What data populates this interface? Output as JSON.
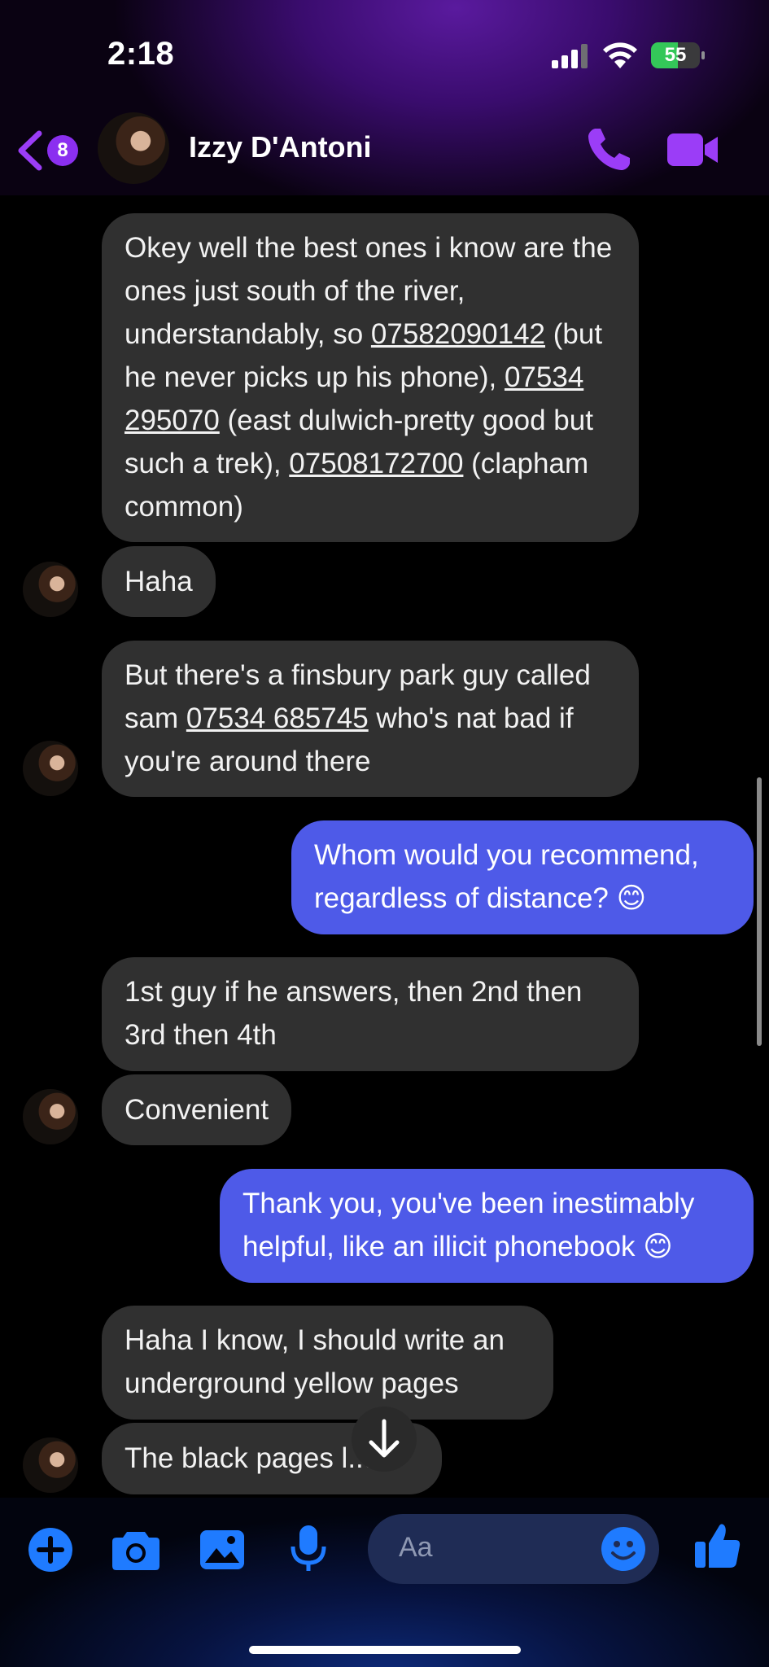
{
  "status_bar": {
    "time": "2:18",
    "battery_level": "55",
    "battery_fraction": 0.55
  },
  "header": {
    "unread_count": "8",
    "contact_name": "Izzy D'Antoni",
    "accent_color": "#9b3df7"
  },
  "messages": [
    {
      "from": "them",
      "segments": [
        {
          "t": "Okey well the best ones i know are the ones just south of the river, understandably, so "
        },
        {
          "t": "07582090142",
          "phone": true
        },
        {
          "t": " (but he never picks up his phone), "
        },
        {
          "t": "07534 295070",
          "phone": true
        },
        {
          "t": " (east dulwich-pretty good but such a trek), "
        },
        {
          "t": "07508172700",
          "phone": true
        },
        {
          "t": " (clapham common)"
        }
      ]
    },
    {
      "from": "them",
      "text": "Haha"
    },
    {
      "from": "them",
      "segments": [
        {
          "t": "But there's a finsbury park guy called sam "
        },
        {
          "t": "07534 685745",
          "phone": true
        },
        {
          "t": " who's nat bad if you're around there"
        }
      ]
    },
    {
      "from": "me",
      "text": "Whom would you recommend, regardless of distance? 😊"
    },
    {
      "from": "them",
      "text": "1st guy if he answers, then 2nd then 3rd then 4th"
    },
    {
      "from": "them",
      "text": "Convenient"
    },
    {
      "from": "me",
      "text": "Thank you, you've been inestimably helpful, like an illicit phonebook 😊"
    },
    {
      "from": "them",
      "text": "Haha I know, I should write an underground yellow pages"
    },
    {
      "from": "them",
      "text": "The black pages l..d"
    }
  ],
  "composer": {
    "placeholder": "Aa",
    "icon_names": [
      "plus-icon",
      "camera-icon",
      "gallery-icon",
      "microphone-icon",
      "emoji-icon",
      "thumbs-up-icon"
    ],
    "icon_color": "#1f7bff"
  }
}
